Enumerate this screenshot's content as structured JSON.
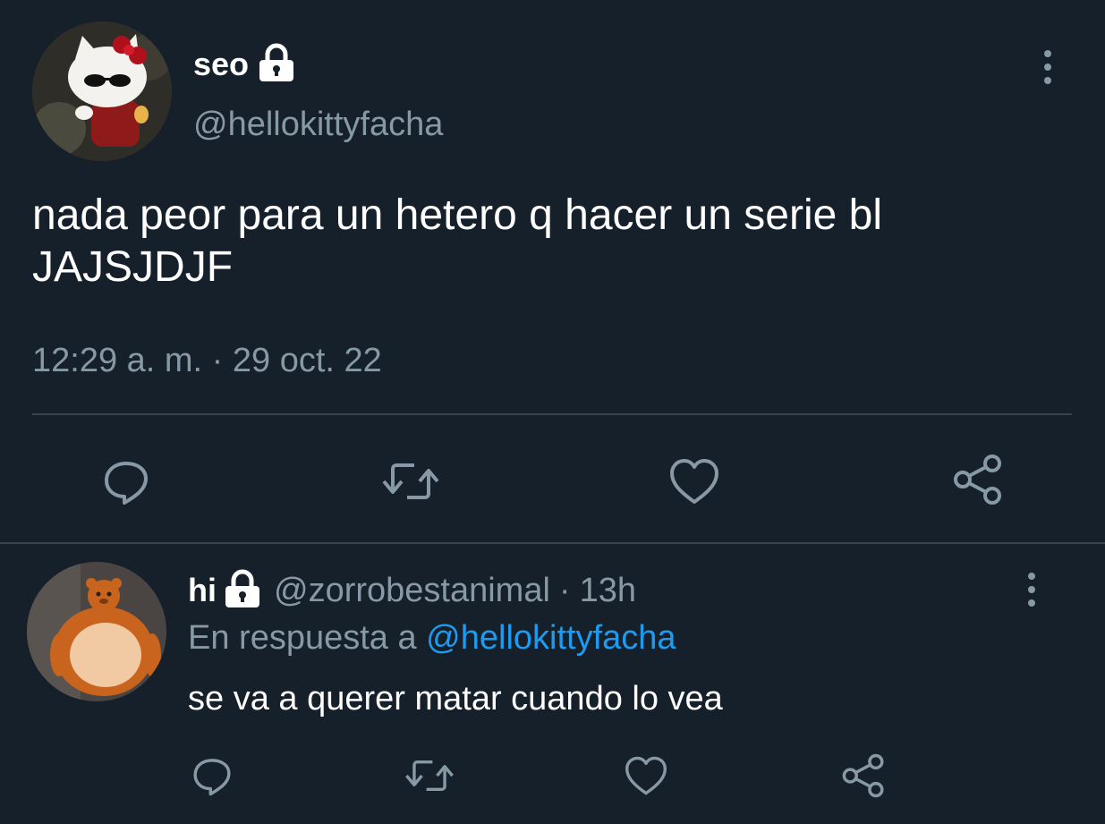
{
  "main_tweet": {
    "display_name": "seo",
    "handle": "@hellokittyfacha",
    "text_line1": "nada peor para un hetero q hacer un serie bl",
    "text_line2": "JAJSJDJF",
    "timestamp": "12:29 a. m. · 29 oct. 22",
    "avatar_icon": "hello-kitty-avatar",
    "lock_icon": "lock-icon",
    "actions": [
      "reply-icon",
      "retweet-icon",
      "like-icon",
      "share-icon"
    ]
  },
  "reply": {
    "display_name": "hi",
    "handle": "@zorrobestanimal",
    "separator": "·",
    "age": "13h",
    "reply_prefix": "En respuesta a",
    "reply_to": "@hellokittyfacha",
    "text": "se va a querer matar cuando lo vea",
    "avatar_icon": "teddy-bear-avatar",
    "lock_icon": "lock-icon",
    "actions": [
      "reply-icon",
      "retweet-icon",
      "like-icon",
      "share-icon"
    ]
  },
  "colors": {
    "background": "#15202b",
    "muted": "#8899a6",
    "link": "#1d9bf0",
    "divider": "#38444d"
  }
}
